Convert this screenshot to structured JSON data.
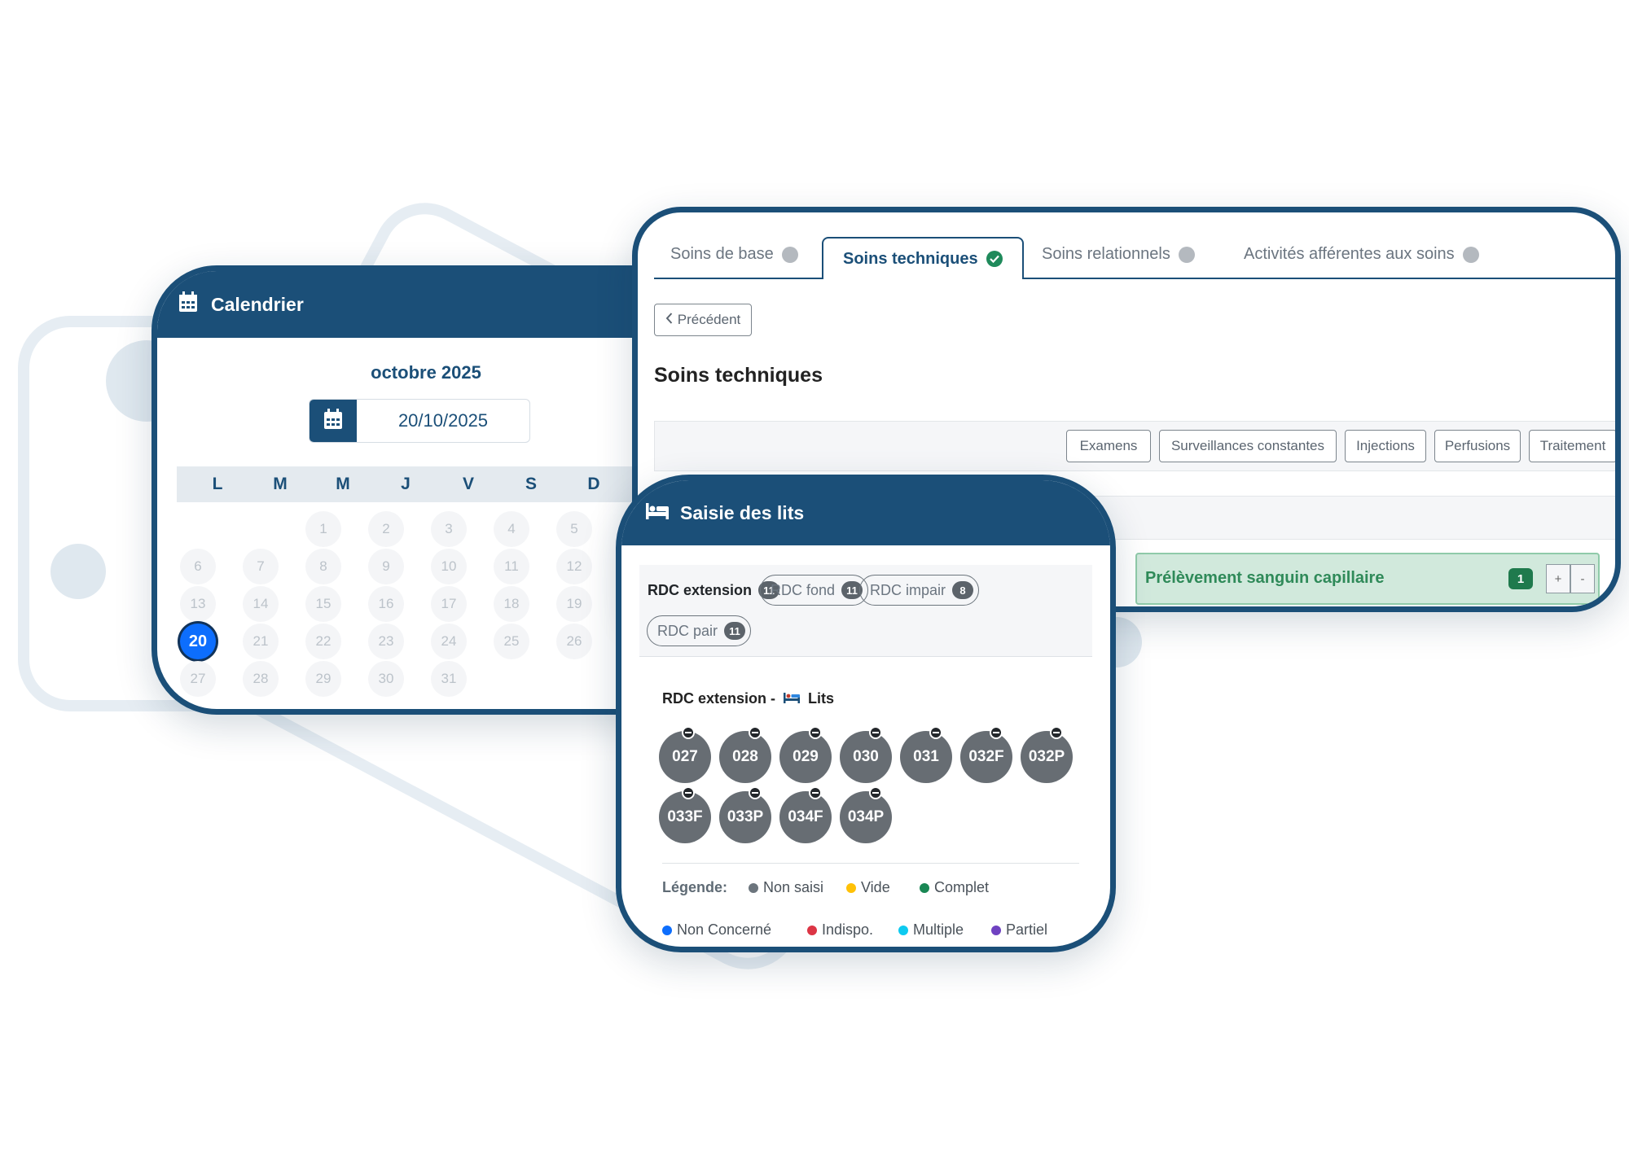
{
  "calendar": {
    "title": "Calendrier",
    "month": "octobre 2025",
    "date_value": "20/10/2025",
    "weekdays": [
      "L",
      "M",
      "M",
      "J",
      "V",
      "S",
      "D"
    ],
    "days": [
      "1",
      "2",
      "3",
      "4",
      "5",
      "6",
      "7",
      "8",
      "9",
      "10",
      "11",
      "12",
      "13",
      "14",
      "15",
      "16",
      "17",
      "18",
      "19",
      "20",
      "21",
      "22",
      "23",
      "24",
      "25",
      "26",
      "27",
      "28",
      "29",
      "30",
      "31"
    ],
    "selected_day": "20"
  },
  "soins": {
    "tabs": [
      {
        "label": "Soins de base",
        "status": "pending"
      },
      {
        "label": "Soins techniques",
        "status": "done"
      },
      {
        "label": "Soins relationnels",
        "status": "pending"
      },
      {
        "label": "Activités afférentes aux soins",
        "status": "pending"
      }
    ],
    "prev_label": "Précédent",
    "section_title": "Soins techniques",
    "filters": [
      "Examens",
      "Surveillances constantes",
      "Injections",
      "Perfusions",
      "Traitement"
    ],
    "item": {
      "label": "Prélèvement sanguin capillaire",
      "count": "1",
      "plus": "+",
      "minus": "-"
    }
  },
  "lits": {
    "title": "Saisie des lits",
    "sectors": [
      {
        "label": "RDC extension",
        "count": "11"
      },
      {
        "label": "RDC fond",
        "count": "11"
      },
      {
        "label": "RDC impair",
        "count": "8"
      },
      {
        "label": "RDC pair",
        "count": "11"
      }
    ],
    "sector_title": "RDC extension -",
    "beds_label": "Lits",
    "beds": [
      "027",
      "028",
      "029",
      "030",
      "031",
      "032F",
      "032P",
      "033F",
      "033P",
      "034F",
      "034P"
    ],
    "legend_label": "Légende:",
    "legend": [
      {
        "label": "Non saisi",
        "color": "#6c757d"
      },
      {
        "label": "Vide",
        "color": "#ffc107"
      },
      {
        "label": "Complet",
        "color": "#198754"
      },
      {
        "label": "Non Concerné",
        "color": "#0d6efd"
      },
      {
        "label": "Indispo.",
        "color": "#dc3545"
      },
      {
        "label": "Multiple",
        "color": "#0dcaf0"
      },
      {
        "label": "Partiel",
        "color": "#6f42c1"
      }
    ]
  }
}
